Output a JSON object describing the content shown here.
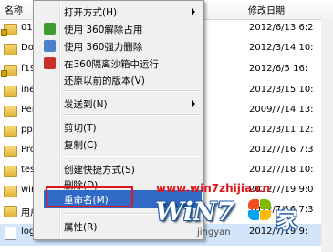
{
  "columns": {
    "name": "名称",
    "modified": "修改日期"
  },
  "files": [
    {
      "name": "016",
      "date": "2012/6/13 6:2",
      "icon": "locked-folder-icon"
    },
    {
      "name": "Dow",
      "date": "2012/3/14 10:",
      "icon": "folder-icon"
    },
    {
      "name": "f19",
      "date": "2012/6/5 16:",
      "icon": "locked-folder-icon"
    },
    {
      "name": "ine",
      "date": "2012/3/15 10:",
      "icon": "folder-icon"
    },
    {
      "name": "Per",
      "date": "2009/7/14 13:",
      "icon": "folder-icon"
    },
    {
      "name": "ppm",
      "date": "2012/3/11 12:",
      "icon": "folder-icon"
    },
    {
      "name": "Pro",
      "date": "2012/7/16 7:3",
      "icon": "folder-icon"
    },
    {
      "name": "tes",
      "date": "2012/7/18 10:",
      "icon": "folder-icon"
    },
    {
      "name": "win",
      "date": "2012/7/19 9:0",
      "icon": "folder-icon"
    },
    {
      "name": "用户",
      "date": "2012/7/16 7:3",
      "icon": "folder-icon"
    },
    {
      "name": "log",
      "date": "2012/7/19 9:",
      "icon": "document-icon"
    }
  ],
  "menu": {
    "items": [
      {
        "label": "打开方式(H)",
        "submenu": true
      },
      {
        "label": "使用 360解除占用",
        "icon": "360-unlock-icon"
      },
      {
        "label": "使用 360强力删除",
        "icon": "360-shred-icon"
      },
      {
        "label": "在360隔离沙箱中运行",
        "icon": "360-sandbox-icon"
      },
      {
        "label": "还原以前的版本(V)"
      },
      {
        "label": "发送到(N)",
        "submenu": true
      },
      {
        "label": "剪切(T)"
      },
      {
        "label": "复制(C)"
      },
      {
        "label": "创建快捷方式(S)"
      },
      {
        "label": "删除(D)"
      },
      {
        "label": "重命名(M)",
        "highlighted": true
      },
      {
        "label": "属性(R)"
      }
    ]
  },
  "watermark": {
    "url": "www.win7zhijia.cn",
    "logo": "WiN7",
    "home": "家",
    "sub": "jingyan"
  },
  "colors": {
    "highlight": "#3169c6",
    "callout": "#e0161c",
    "selected_row": "#d3e5fa"
  }
}
